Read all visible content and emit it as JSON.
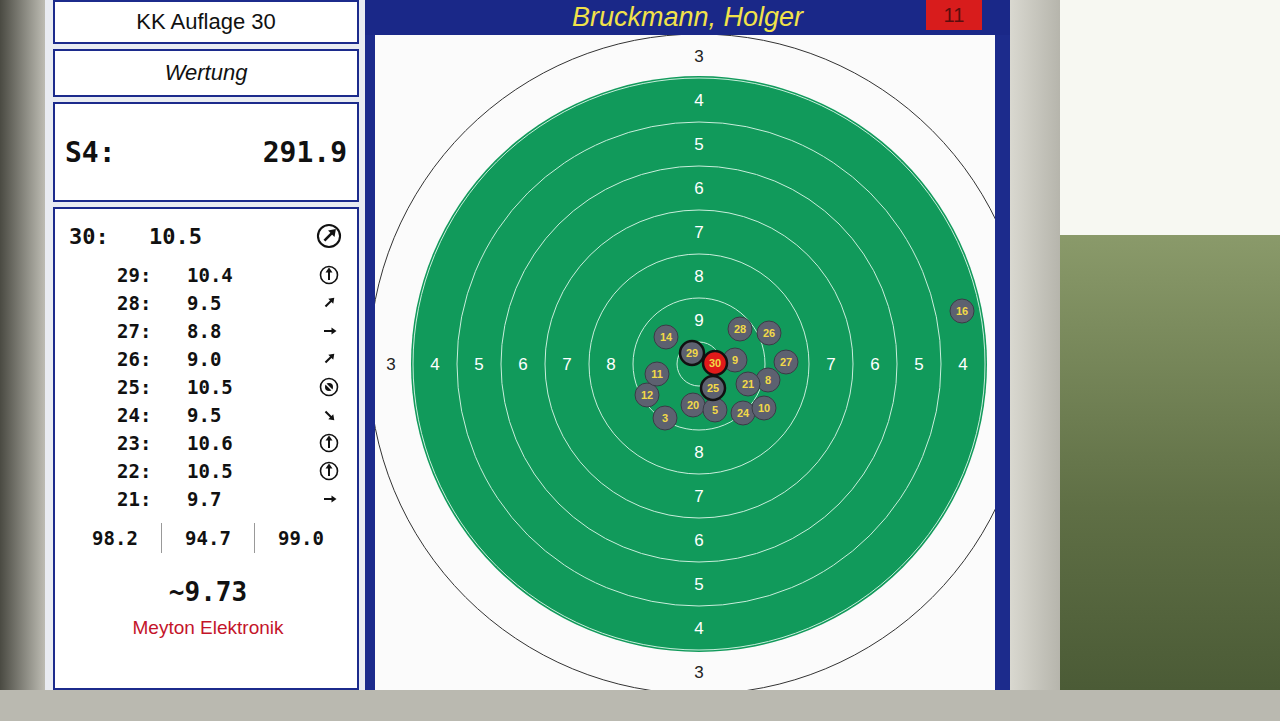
{
  "discipline": "KK Auflage 30",
  "mode": "Wertung",
  "series": {
    "label": "S4:",
    "total": "291.9"
  },
  "shooter": {
    "name": "Bruckmann, Holger",
    "lane": "11"
  },
  "current_shot": {
    "number": "30:",
    "value": "10.5",
    "kind": "arrow",
    "direction": 45,
    "circled": true
  },
  "shot_list": [
    {
      "number": "29:",
      "value": "10.4",
      "kind": "arrow",
      "direction": 0,
      "circled": true
    },
    {
      "number": "28:",
      "value": "9.5",
      "kind": "arrow",
      "direction": 45,
      "circled": false
    },
    {
      "number": "27:",
      "value": "8.8",
      "kind": "arrow",
      "direction": 90,
      "circled": false
    },
    {
      "number": "26:",
      "value": "9.0",
      "kind": "arrow",
      "direction": 45,
      "circled": false
    },
    {
      "number": "25:",
      "value": "10.5",
      "kind": "center",
      "direction": 0,
      "circled": true
    },
    {
      "number": "24:",
      "value": "9.5",
      "kind": "arrow",
      "direction": 135,
      "circled": false
    },
    {
      "number": "23:",
      "value": "10.6",
      "kind": "arrow",
      "direction": 0,
      "circled": true
    },
    {
      "number": "22:",
      "value": "10.5",
      "kind": "arrow",
      "direction": 0,
      "circled": true
    },
    {
      "number": "21:",
      "value": "9.7",
      "kind": "arrow",
      "direction": 90,
      "circled": false
    }
  ],
  "series_sums": [
    "98.2",
    "94.7",
    "99.0"
  ],
  "average": "~9.73",
  "brand": "Meyton Elektronik",
  "target": {
    "rings": [
      {
        "value": "3",
        "sides": [
          "top",
          "bottom",
          "left",
          "right"
        ]
      },
      {
        "value": "4",
        "sides": [
          "top",
          "bottom",
          "left",
          "right"
        ]
      },
      {
        "value": "5",
        "sides": [
          "top",
          "bottom",
          "left",
          "right"
        ]
      },
      {
        "value": "6",
        "sides": [
          "top",
          "bottom",
          "left",
          "right"
        ]
      },
      {
        "value": "7",
        "sides": [
          "top",
          "bottom",
          "left",
          "right"
        ]
      },
      {
        "value": "8",
        "sides": [
          "top",
          "bottom",
          "left"
        ]
      },
      {
        "value": "9",
        "sides": [
          "top",
          "bottom"
        ]
      }
    ],
    "shots": [
      {
        "label": "16",
        "dx": 263,
        "dy": -53,
        "last": false,
        "outlined": false
      },
      {
        "label": "14",
        "dx": -33,
        "dy": -27,
        "last": false,
        "outlined": false
      },
      {
        "label": "12",
        "dx": -52,
        "dy": 31,
        "last": false,
        "outlined": false
      },
      {
        "label": "11",
        "dx": -42,
        "dy": 10,
        "last": false,
        "outlined": false
      },
      {
        "label": "3",
        "dx": -34,
        "dy": 54,
        "last": false,
        "outlined": false
      },
      {
        "label": "20",
        "dx": -6,
        "dy": 41,
        "last": false,
        "outlined": false
      },
      {
        "label": "5",
        "dx": 16,
        "dy": 46,
        "last": false,
        "outlined": false
      },
      {
        "label": "24",
        "dx": 44,
        "dy": 49,
        "last": false,
        "outlined": false
      },
      {
        "label": "10",
        "dx": 65,
        "dy": 44,
        "last": false,
        "outlined": false
      },
      {
        "label": "8",
        "dx": 69,
        "dy": 16,
        "last": false,
        "outlined": false
      },
      {
        "label": "21",
        "dx": 49,
        "dy": 20,
        "last": false,
        "outlined": false
      },
      {
        "label": "27",
        "dx": 87,
        "dy": -2,
        "last": false,
        "outlined": false
      },
      {
        "label": "26",
        "dx": 70,
        "dy": -31,
        "last": false,
        "outlined": false
      },
      {
        "label": "28",
        "dx": 41,
        "dy": -35,
        "last": false,
        "outlined": false
      },
      {
        "label": "9",
        "dx": 36,
        "dy": -4,
        "last": false,
        "outlined": false
      },
      {
        "label": "25",
        "dx": 14,
        "dy": 24,
        "last": false,
        "outlined": true
      },
      {
        "label": "29",
        "dx": -7,
        "dy": -11,
        "last": false,
        "outlined": true
      },
      {
        "label": "30",
        "dx": 16,
        "dy": -1,
        "last": true,
        "outlined": true
      }
    ]
  }
}
